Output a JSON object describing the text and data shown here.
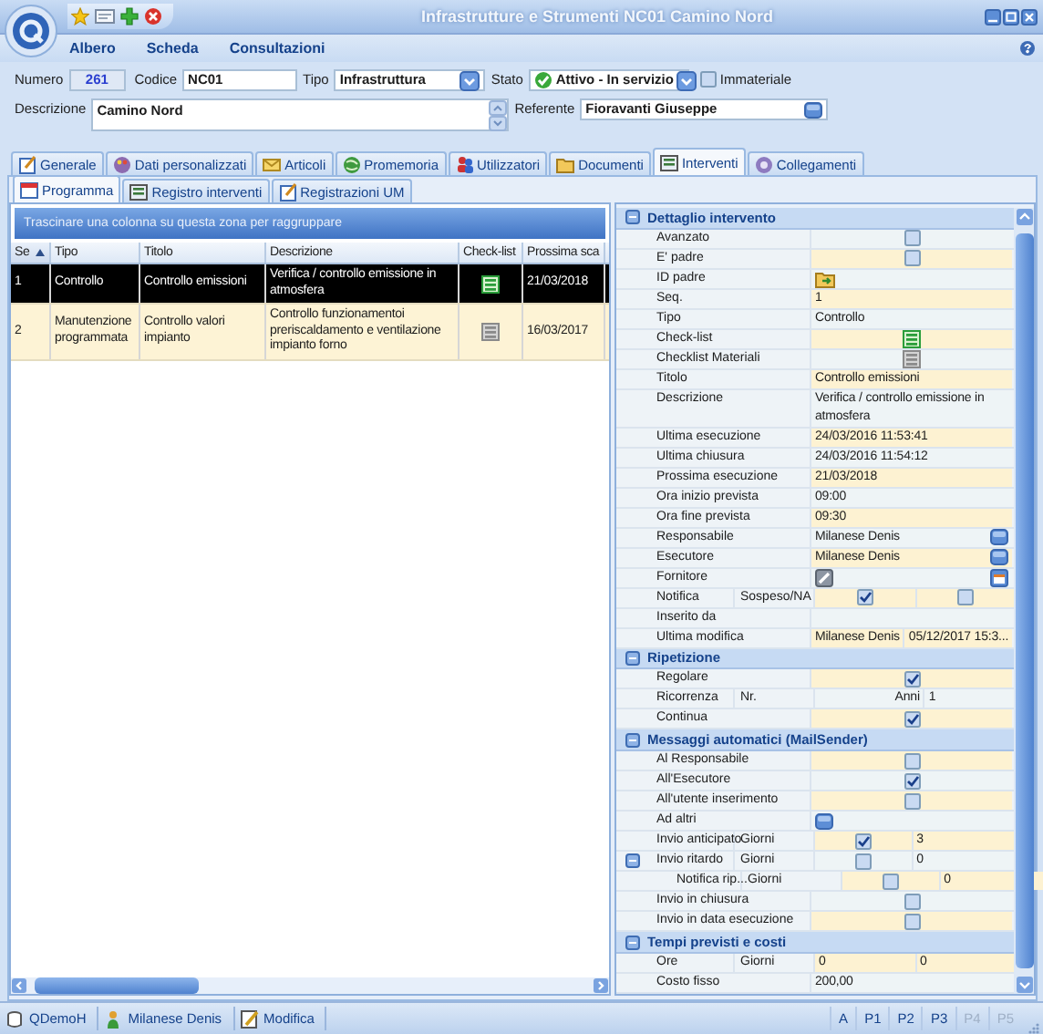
{
  "window": {
    "title": "Infrastrutture e Strumenti NC01 Camino Nord"
  },
  "menu": [
    "Albero",
    "Scheda",
    "Consultazioni"
  ],
  "form_rows": [
    [
      {
        "kind": "number",
        "label": "Numero",
        "value": "261"
      },
      {
        "kind": "text",
        "label": "Codice",
        "value": "NC01"
      },
      {
        "kind": "dropdown",
        "label": "Tipo",
        "value": "Infrastruttura"
      },
      {
        "kind": "status",
        "label": "Stato",
        "value": "Attivo - In servizio"
      },
      {
        "kind": "checkbox",
        "label": "Immateriale",
        "checked": false
      }
    ],
    [
      {
        "kind": "memo",
        "label": "Descrizione",
        "value": "Camino Nord"
      },
      {
        "kind": "picker",
        "label": "Referente",
        "value": "Fioravanti Giuseppe"
      }
    ]
  ],
  "tabs": [
    {
      "label": "Generale",
      "selected": false
    },
    {
      "label": "Dati personalizzati",
      "selected": false
    },
    {
      "label": "Articoli",
      "selected": false
    },
    {
      "label": "Promemoria",
      "selected": false
    },
    {
      "label": "Utilizzatori",
      "selected": false
    },
    {
      "label": "Documenti",
      "selected": false
    },
    {
      "label": "Interventi",
      "selected": true
    },
    {
      "label": "Collegamenti",
      "selected": false
    }
  ],
  "subtabs": [
    {
      "label": "Programma",
      "selected": true
    },
    {
      "label": "Registro interventi",
      "selected": false
    },
    {
      "label": "Registrazioni UM",
      "selected": false
    }
  ],
  "grid": {
    "group_hint": "Trascinare una colonna su questa zona per raggruppare",
    "columns": [
      {
        "label": "Se",
        "sorted": true
      },
      {
        "label": "Tipo",
        "sorted": false
      },
      {
        "label": "Titolo",
        "sorted": false
      },
      {
        "label": "Descrizione",
        "sorted": false
      },
      {
        "label": "Check-list",
        "sorted": false
      },
      {
        "label": "Prossima sca",
        "sorted": false
      }
    ],
    "rows": [
      {
        "selected": true,
        "cells": [
          {
            "kind": "text",
            "text": "1"
          },
          {
            "kind": "text",
            "text": "Controllo"
          },
          {
            "kind": "text",
            "text": "Controllo emissioni"
          },
          {
            "kind": "text",
            "text": "Verifica / controllo emissione in atmosfera"
          },
          {
            "kind": "checklist",
            "active": true
          },
          {
            "kind": "text",
            "text": "21/03/2018"
          }
        ]
      },
      {
        "selected": false,
        "cells": [
          {
            "kind": "text",
            "text": "2"
          },
          {
            "kind": "text",
            "text": "Manutenzione programmata"
          },
          {
            "kind": "text",
            "text": "Controllo valori impianto"
          },
          {
            "kind": "text",
            "text": "Controllo funzionamentoi preriscaldamento e ventilazione impianto forno"
          },
          {
            "kind": "checklist",
            "active": false
          },
          {
            "kind": "text",
            "text": "16/03/2017"
          }
        ]
      }
    ]
  },
  "details": {
    "sections": [
      {
        "title": "Dettaglio intervento",
        "expanded": true,
        "rows": [
          {
            "label": "Avanzato",
            "cells": [
              {
                "kind": "check",
                "checked": false
              }
            ]
          },
          {
            "label": "E' padre",
            "cells": [
              {
                "kind": "check",
                "checked": false
              }
            ]
          },
          {
            "label": "ID padre",
            "cells": [
              {
                "kind": "folder"
              }
            ]
          },
          {
            "label": "Seq.",
            "cells": [
              {
                "kind": "text",
                "text": "1"
              }
            ]
          },
          {
            "label": "Tipo",
            "cells": [
              {
                "kind": "text",
                "text": "Controllo"
              }
            ]
          },
          {
            "label": "Check-list",
            "cells": [
              {
                "kind": "checklist",
                "active": true
              }
            ]
          },
          {
            "label": "Checklist Materiali",
            "cells": [
              {
                "kind": "checklist",
                "active": false
              }
            ]
          },
          {
            "label": "Titolo",
            "cells": [
              {
                "kind": "text",
                "text": "Controllo emissioni"
              }
            ]
          },
          {
            "label": "Descrizione",
            "cells": [
              {
                "kind": "text",
                "text": "Verifica / controllo emissione in atmosfera"
              }
            ]
          },
          {
            "label": "Ultima esecuzione",
            "cells": [
              {
                "kind": "text",
                "text": "24/03/2016 11:53:41"
              }
            ]
          },
          {
            "label": "Ultima chiusura",
            "cells": [
              {
                "kind": "text",
                "text": "24/03/2016 11:54:12"
              }
            ]
          },
          {
            "label": "Prossima esecuzione",
            "cells": [
              {
                "kind": "text",
                "text": "21/03/2018"
              }
            ]
          },
          {
            "label": "Ora inizio prevista",
            "cells": [
              {
                "kind": "text",
                "text": "09:00"
              }
            ]
          },
          {
            "label": "Ora fine prevista",
            "cells": [
              {
                "kind": "text",
                "text": "09:30"
              }
            ]
          },
          {
            "label": "Responsabile",
            "cells": [
              {
                "kind": "picker",
                "text": "Milanese Denis"
              }
            ]
          },
          {
            "label": "Esecutore",
            "cells": [
              {
                "kind": "picker",
                "text": "Milanese Denis"
              }
            ]
          },
          {
            "label": "Fornitore",
            "cells": [
              {
                "kind": "edit-picker"
              }
            ]
          },
          {
            "label": "Notifica",
            "sub": "Sospeso/NA",
            "cells": [
              {
                "kind": "check",
                "checked": true
              },
              {
                "kind": "check",
                "checked": false
              }
            ]
          },
          {
            "label": "Inserito da"
          },
          {
            "label": "Ultima modifica",
            "cells": [
              {
                "kind": "text",
                "text": "Milanese Denis"
              },
              {
                "kind": "text",
                "text": "05/12/2017 15:3..."
              }
            ]
          }
        ]
      },
      {
        "title": "Ripetizione",
        "expanded": true,
        "rows": [
          {
            "label": "Regolare",
            "cells": [
              {
                "kind": "check",
                "checked": true
              }
            ]
          },
          {
            "label": "Ricorrenza",
            "sub": "Nr.",
            "cells": [
              {
                "kind": "unit",
                "text": "Anni"
              },
              {
                "kind": "text",
                "text": "1"
              }
            ]
          },
          {
            "label": "Continua",
            "cells": [
              {
                "kind": "check",
                "checked": true
              }
            ]
          }
        ]
      },
      {
        "title": "Messaggi automatici (MailSender)",
        "expanded": true,
        "rows": [
          {
            "label": "Al Responsabile",
            "cells": [
              {
                "kind": "check",
                "checked": false
              }
            ]
          },
          {
            "label": "All'Esecutore",
            "cells": [
              {
                "kind": "check",
                "checked": true
              }
            ]
          },
          {
            "label": "All'utente inserimento",
            "cells": [
              {
                "kind": "check",
                "checked": false
              }
            ]
          },
          {
            "label": "Ad altri",
            "cells": [
              {
                "kind": "picker"
              }
            ]
          },
          {
            "label": "Invio anticipato",
            "sub": "Giorni",
            "cells": [
              {
                "kind": "check",
                "checked": true
              },
              {
                "kind": "text",
                "text": "3"
              }
            ]
          },
          {
            "label": "Invio ritardo",
            "sub": "Giorni",
            "expanded": true,
            "cells": [
              {
                "kind": "check",
                "checked": false
              },
              {
                "kind": "text",
                "text": "0"
              }
            ],
            "children": [
              {
                "label": "Notifica rip...",
                "sub": "Giorni",
                "cells": [
                  {
                    "kind": "check",
                    "checked": false
                  },
                  {
                    "kind": "text",
                    "text": "0"
                  }
                ]
              }
            ]
          },
          {
            "label": "Invio in chiusura",
            "cells": [
              {
                "kind": "check",
                "checked": false
              }
            ]
          },
          {
            "label": "Invio in data esecuzione",
            "cells": [
              {
                "kind": "check",
                "checked": false
              }
            ]
          }
        ]
      },
      {
        "title": "Tempi previsti e costi",
        "expanded": true,
        "rows": [
          {
            "label": "Ore",
            "sub": "Giorni",
            "cells": [
              {
                "kind": "text",
                "text": "0"
              },
              {
                "kind": "text",
                "text": "0"
              }
            ]
          },
          {
            "label": "Costo fisso",
            "cells": [
              {
                "kind": "text",
                "text": "200,00"
              }
            ]
          }
        ]
      }
    ]
  },
  "status_bar": {
    "items": [
      {
        "label": "QDemoH"
      },
      {
        "label": "Milanese Denis"
      },
      {
        "label": "Modifica"
      }
    ],
    "panels": [
      {
        "label": "A",
        "disabled": false
      },
      {
        "label": "P1",
        "disabled": false
      },
      {
        "label": "P2",
        "disabled": false
      },
      {
        "label": "P3",
        "disabled": false
      },
      {
        "label": "P4",
        "disabled": true
      },
      {
        "label": "P5",
        "disabled": true
      }
    ]
  }
}
